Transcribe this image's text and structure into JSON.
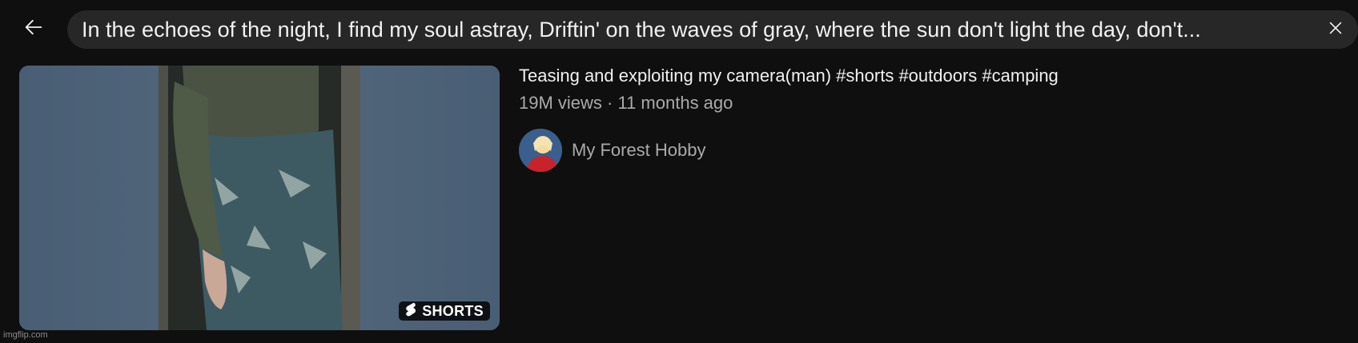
{
  "search": {
    "query": "In the echoes of the night, I find my soul astray, Driftin' on the waves of gray, where the sun don't light the day, don't..."
  },
  "icons": {
    "back": "arrow-left-icon",
    "clear": "close-icon",
    "shorts": "shorts-logo-icon"
  },
  "video": {
    "title": "Teasing and exploiting my camera(man) #shorts #outdoors #camping",
    "meta": "19M views · 11 months ago",
    "badge_label": "SHORTS",
    "channel": "My Forest Hobby"
  },
  "watermark": "imgflip.com",
  "colors": {
    "background": "#0f0f0f",
    "search_bg": "#272727",
    "secondary_text": "#aaaaaa",
    "thumb_side": "#4a5f76"
  }
}
